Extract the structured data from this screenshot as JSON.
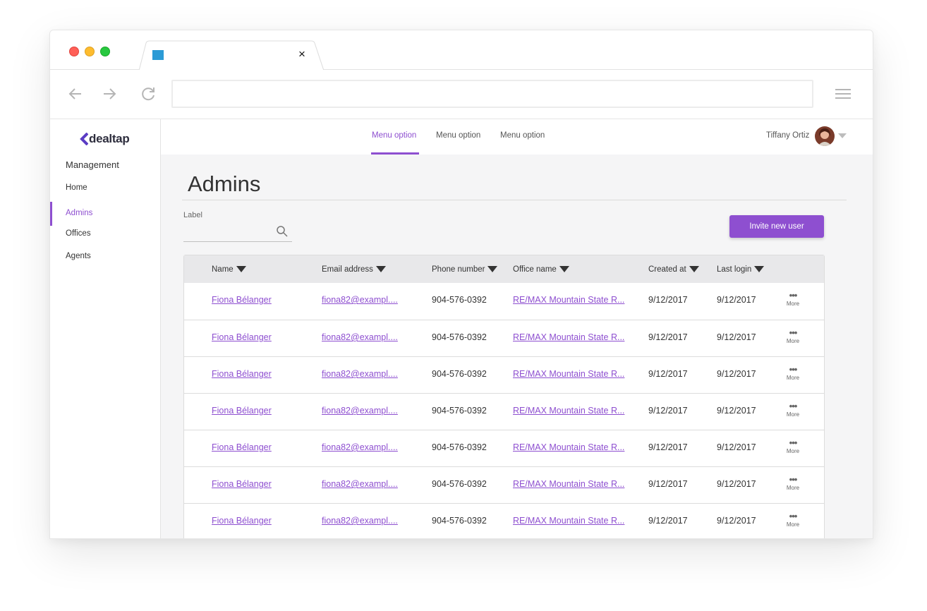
{
  "browser": {
    "tab": {
      "title": "",
      "close_glyph": "×"
    },
    "url": "",
    "icons": [
      "back-arrow-icon",
      "forward-arrow-icon",
      "reload-icon",
      "hamburger-menu-icon",
      "favicon-icon"
    ]
  },
  "sidebar": {
    "logo": "dealtap",
    "heading": "Management",
    "items": [
      {
        "label": "Home",
        "active": false
      },
      {
        "label": "Admins",
        "active": true
      },
      {
        "label": "Offices",
        "active": false
      },
      {
        "label": "Agents",
        "active": false
      }
    ]
  },
  "topnav": {
    "menu": [
      {
        "label": "Menu option",
        "active": true
      },
      {
        "label": "Menu option",
        "active": false
      },
      {
        "label": "Menu option",
        "active": false
      }
    ],
    "user_name": "Tiffany Ortiz"
  },
  "page": {
    "title": "Admins",
    "search": {
      "label": "Label",
      "value": "",
      "placeholder": ""
    },
    "invite_button": "Invite new user"
  },
  "table": {
    "columns": [
      "Name",
      "Email address",
      "Phone number",
      "Office name",
      "Created at",
      "Last login"
    ],
    "rows": [
      {
        "name": "Fiona Bélanger",
        "email": "fiona82@exampl....",
        "phone": "904-576-0392",
        "office": "RE/MAX Mountain State R...",
        "created": "9/12/2017",
        "last_login": "9/12/2017",
        "more": "More"
      },
      {
        "name": "Fiona Bélanger",
        "email": "fiona82@exampl....",
        "phone": "904-576-0392",
        "office": "RE/MAX Mountain State R...",
        "created": "9/12/2017",
        "last_login": "9/12/2017",
        "more": "More"
      },
      {
        "name": "Fiona Bélanger",
        "email": "fiona82@exampl....",
        "phone": "904-576-0392",
        "office": "RE/MAX Mountain State R...",
        "created": "9/12/2017",
        "last_login": "9/12/2017",
        "more": "More"
      },
      {
        "name": "Fiona Bélanger",
        "email": "fiona82@exampl....",
        "phone": "904-576-0392",
        "office": "RE/MAX Mountain State R...",
        "created": "9/12/2017",
        "last_login": "9/12/2017",
        "more": "More"
      },
      {
        "name": "Fiona Bélanger",
        "email": "fiona82@exampl....",
        "phone": "904-576-0392",
        "office": "RE/MAX Mountain State R...",
        "created": "9/12/2017",
        "last_login": "9/12/2017",
        "more": "More"
      },
      {
        "name": "Fiona Bélanger",
        "email": "fiona82@exampl....",
        "phone": "904-576-0392",
        "office": "RE/MAX Mountain State R...",
        "created": "9/12/2017",
        "last_login": "9/12/2017",
        "more": "More"
      },
      {
        "name": "Fiona Bélanger",
        "email": "fiona82@exampl....",
        "phone": "904-576-0392",
        "office": "RE/MAX Mountain State R...",
        "created": "9/12/2017",
        "last_login": "9/12/2017",
        "more": "More"
      }
    ]
  },
  "colors": {
    "accent": "#8e4fd0",
    "header_bg": "#e8e8ea",
    "page_bg": "#f5f5f6"
  }
}
